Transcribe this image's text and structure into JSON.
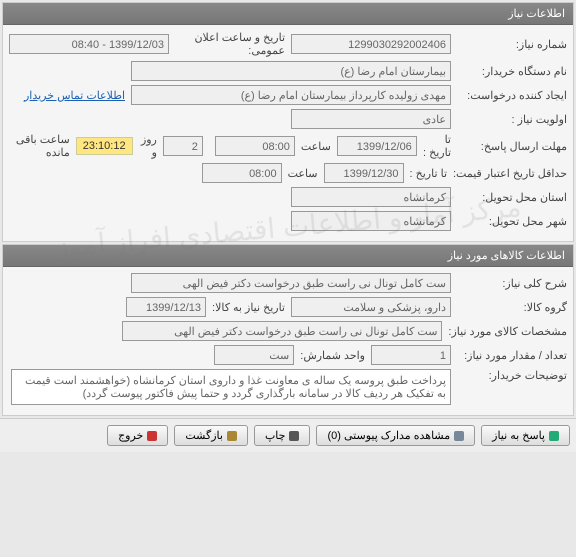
{
  "panel1": {
    "title": "اطلاعات نیاز",
    "need_no_label": "شماره نیاز:",
    "need_no": "1299030292002406",
    "public_date_label": "تاریخ و ساعت اعلان عمومی:",
    "public_date": "1399/12/03 - 08:40",
    "device_label": "نام دستگاه خریدار:",
    "device": "بیمارستان امام رضا (ع)",
    "creator_label": "ایجاد کننده درخواست:",
    "creator": "مهدی زولیده کارپرداز بیمارستان امام رضا (ع)",
    "contact_link": "اطلاعات تماس خریدار",
    "priority_label": "اولویت نیاز :",
    "priority": "عادی",
    "reply_deadline_label": "مهلت ارسال پاسخ:",
    "to_date_label": "تا تاریخ :",
    "reply_date": "1399/12/06",
    "time_label": "ساعت",
    "reply_time": "08:00",
    "days_val": "2",
    "days_label": "روز و",
    "timer": "23:10:12",
    "remain_label": "ساعت باقی مانده",
    "min_validity_label": "حداقل تاریخ اعتبار قیمت:",
    "validity_date": "1399/12/30",
    "validity_time": "08:00",
    "province_label": "استان محل تحویل:",
    "province": "کرمانشاه",
    "city_label": "شهر محل تحویل:",
    "city": "کرمانشاه"
  },
  "panel2": {
    "title": "اطلاعات کالاهای مورد نیاز",
    "desc_label": "شرح کلی نیاز:",
    "desc": "ست کامل تونال نی راست طبق درخواست دکتر فیض الهی",
    "group_label": "گروه کالا:",
    "group": "دارو، پزشکی و سلامت",
    "deliver_to_label": "تاریخ نیاز به کالا:",
    "deliver_to": "1399/12/13",
    "spec_label": "مشخصات کالای مورد نیاز:",
    "spec": "ست کامل تونال نی راست طبق درخواست دکتر فیض الهی",
    "qty_label": "تعداد / مقدار مورد نیاز:",
    "qty": "1",
    "unit_label": "واحد شمارش:",
    "unit": "ست",
    "notes_label": "توضیحات خریدار:",
    "notes": "پرداخت طبق پروسه یک ساله ی معاونت غذا و داروی استان کرمانشاه (خواهشمند است قیمت به تفکیک هر ردیف کالا در سامانه بارگذاری گردد و حتما پیش فاکتور پیوست گردد)"
  },
  "buttons": {
    "reply": "پاسخ به نیاز",
    "attach": "مشاهده مدارک پیوستی (0)",
    "print": "چاپ",
    "back": "بازگشت",
    "exit": "خروج"
  },
  "watermark": "مرکز آمار و اطلاعات اقتصادی\nافراز آموز"
}
